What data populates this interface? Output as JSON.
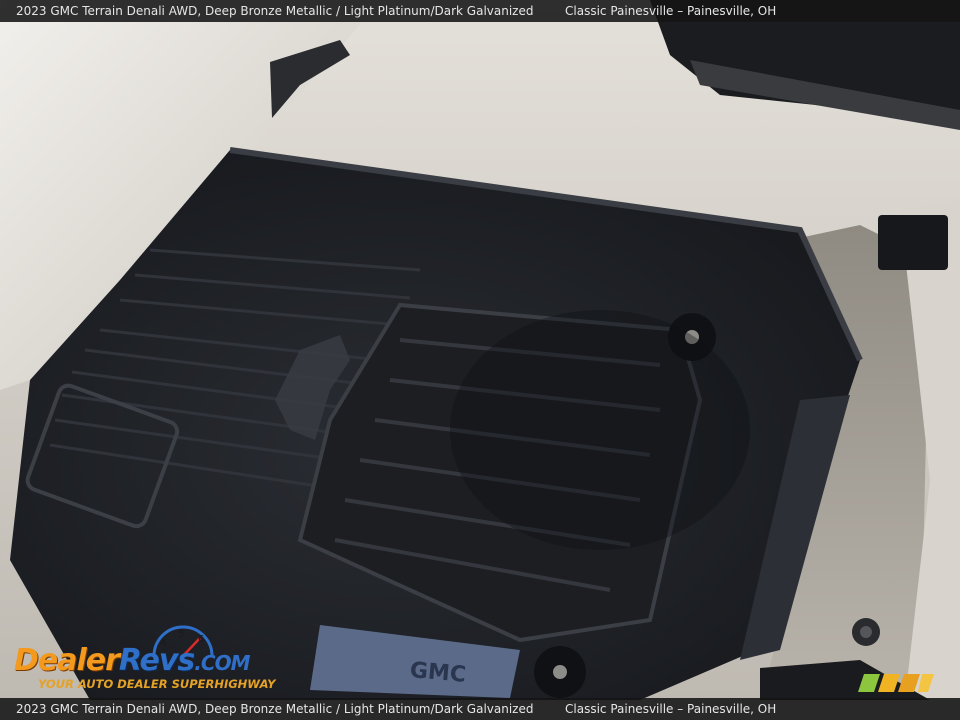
{
  "caption": {
    "top_left": "2023 GMC Terrain Denali AWD,  Deep Bronze Metallic / Light Platinum/Dark Galvanized",
    "top_right": "Classic Painesville – Painesville, OH",
    "bottom_left": "2023 GMC Terrain Denali AWD,  Deep Bronze Metallic / Light Platinum/Dark Galvanized",
    "bottom_right": "Classic Painesville – Painesville, OH"
  },
  "photo": {
    "mat_emblem": "GMC"
  },
  "logo": {
    "brand_part1": "Dealer",
    "brand_part2": "Revs",
    "brand_suffix": ".COM",
    "tagline": "YOUR AUTO DEALER SUPERHIGHWAY",
    "speedo_digits": [
      "4",
      "5",
      "6"
    ]
  },
  "colors": {
    "mat": "#1f2126",
    "trim_light": "#d9d5cf",
    "carpet": "#a8a39b",
    "logo_orange": "#f39a1e",
    "logo_blue": "#2f6fc7",
    "watermark_green": "#8cc63f",
    "watermark_yellow": "#f0b323"
  }
}
